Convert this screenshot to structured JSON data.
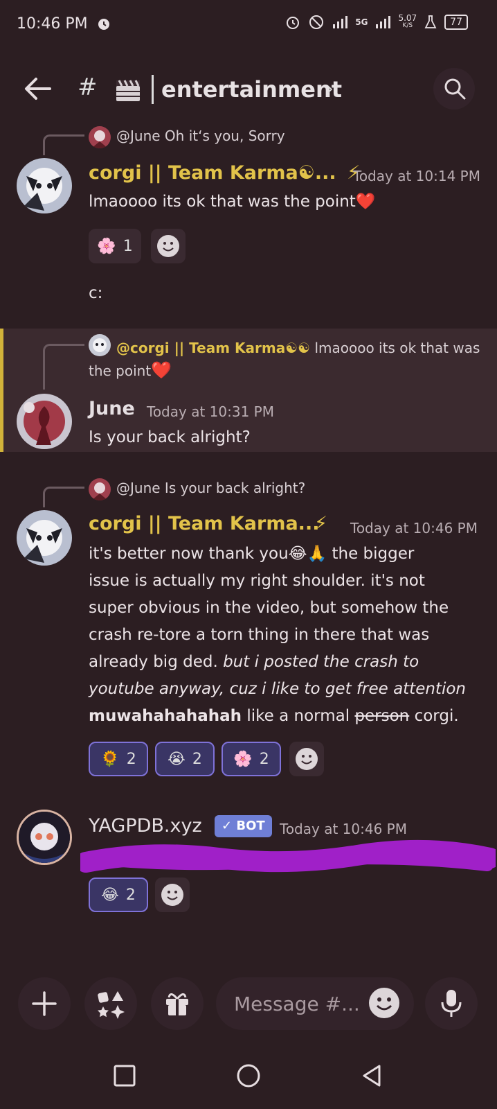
{
  "status_bar": {
    "time": "10:46 PM",
    "network": "5G",
    "speed": "5.07",
    "speed_unit": "K/S",
    "battery": "77"
  },
  "header": {
    "hash": "#",
    "channel_name": "entertainment",
    "chevron": "›"
  },
  "messages": [
    {
      "reply_mention": "@June",
      "reply_text": "Oh it‘s you, Sorry",
      "author": "corgi || Team Karma☯...",
      "author_badge": "⚡",
      "timestamp": "Today at 10:14 PM",
      "text": "lmaoooo its ok that was the point",
      "text_emoji": "❤️",
      "reactions": [
        {
          "emoji": "🌸",
          "count": "1"
        }
      ],
      "followup": "c:"
    },
    {
      "reply_mention": "@corgi || Team Karma☯☯",
      "reply_text": "lmaoooo its ok that was",
      "reply_text_2": "the point",
      "reply_emoji": "❤️",
      "author": "June",
      "timestamp": "Today at 10:31 PM",
      "text": "Is your back alright?"
    },
    {
      "reply_mention": "@June",
      "reply_text": "Is your back alright?",
      "author": "corgi || Team Karma...",
      "author_badge": "⚡",
      "timestamp": "Today at 10:46 PM",
      "text_1a": "it's better now thank you",
      "text_1_emoji": "😂🙏",
      "text_1b": " the bigger",
      "text_2": "issue is actually my right shoulder. it's not",
      "text_3": "super obvious in the video, but somehow the",
      "text_4": "crash re-tore a torn thing in there that was",
      "text_5a": "already big ded. ",
      "text_5b": "but i posted the crash to",
      "text_6": "youtube anyway, cuz i like to get free attention",
      "text_7_bold": "muwahahahahah",
      "text_7a": " like a normal ",
      "text_7_strike": "person",
      "text_7b": " corgi.",
      "reactions": [
        {
          "emoji": "🌻",
          "count": "2"
        },
        {
          "emoji": "😭",
          "count": "2"
        },
        {
          "emoji": "🌸",
          "count": "2"
        }
      ]
    },
    {
      "author": "YAGPDB.xyz",
      "bot_badge": "✓ BOT",
      "timestamp": "Today at 10:46 PM",
      "reactions": [
        {
          "emoji": "😂",
          "count": "2"
        }
      ]
    }
  ],
  "composer": {
    "placeholder": "Message #..."
  },
  "icons": {
    "back": "back-arrow-icon",
    "search": "search-icon",
    "add": "plus-icon",
    "apps": "apps-icon",
    "gift": "gift-icon",
    "emoji": "emoji-icon",
    "mic": "mic-icon"
  },
  "colors": {
    "background": "#2c1e22",
    "gold_name": "#e2c34a",
    "mention_highlight": "#d1b23a",
    "reaction_active": "#7f72d8",
    "redaction": "#a020c8"
  }
}
